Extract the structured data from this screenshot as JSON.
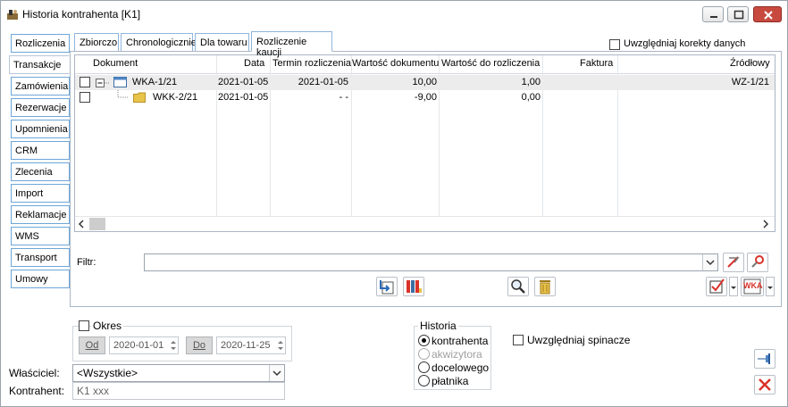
{
  "window": {
    "title": "Historia kontrahenta [K1]"
  },
  "sidebar": {
    "items": [
      {
        "label": "Rozliczenia"
      },
      {
        "label": "Transakcje"
      },
      {
        "label": "Zamówienia"
      },
      {
        "label": "Rezerwacje"
      },
      {
        "label": "Upomnienia"
      },
      {
        "label": "CRM"
      },
      {
        "label": "Zlecenia"
      },
      {
        "label": "Import"
      },
      {
        "label": "Reklamacje"
      },
      {
        "label": "WMS"
      },
      {
        "label": "Transport"
      },
      {
        "label": "Umowy"
      }
    ],
    "active_index": 1
  },
  "tabs": {
    "items": [
      {
        "label": "Zbiorczo"
      },
      {
        "label": "Chronologicznie"
      },
      {
        "label": "Dla towaru"
      },
      {
        "label": "Rozliczenie kaucji"
      }
    ],
    "active_index": 3
  },
  "options": {
    "korekty_label": "Uwzględniaj korekty danych",
    "korekty_checked": false
  },
  "grid": {
    "columns": {
      "dokument": "Dokument",
      "data": "Data",
      "termin": "Termin rozliczenia",
      "wartosc": "Wartość dokumentu",
      "do_rozliczenia": "Wartość do rozliczenia",
      "faktura": "Faktura",
      "zrodlowy": "Źródłowy"
    },
    "rows": [
      {
        "dokument": "WKA-1/21",
        "data": "2021-01-05",
        "termin": "2021-01-05",
        "wartosc": "10,00",
        "do_rozliczenia": "1,00",
        "faktura": "",
        "zrodlowy": "WZ-1/21"
      },
      {
        "dokument": "WKK-2/21",
        "data": "2021-01-05",
        "termin": "- -",
        "wartosc": "-9,00",
        "do_rozliczenia": "0,00",
        "faktura": "",
        "zrodlowy": ""
      }
    ]
  },
  "filter": {
    "label": "Filtr:",
    "value": ""
  },
  "okres": {
    "label": "Okres",
    "checked": false,
    "od_label": "Od",
    "od_value": "2020-01-01",
    "do_label": "Do",
    "do_value": "2020-11-25"
  },
  "historia": {
    "label": "Historia",
    "options": [
      {
        "label": "kontrahenta",
        "selected": true,
        "disabled": false
      },
      {
        "label": "akwizytora",
        "selected": false,
        "disabled": true
      },
      {
        "label": "docelowego",
        "selected": false,
        "disabled": false
      },
      {
        "label": "płatnika",
        "selected": false,
        "disabled": false
      }
    ]
  },
  "spinacze": {
    "label": "Uwzględniaj spinacze",
    "checked": false
  },
  "wlasciciel": {
    "label": "Właściciel:",
    "value": "<Wszystkie>"
  },
  "kontrahent": {
    "label": "Kontrahent:",
    "value": "K1  xxx"
  },
  "toolbar": {
    "wka_label": "WKA"
  },
  "colors": {
    "accent_blue": "#6ea6d8",
    "close_red": "#c84a3f",
    "delete_red": "#d9322a"
  }
}
